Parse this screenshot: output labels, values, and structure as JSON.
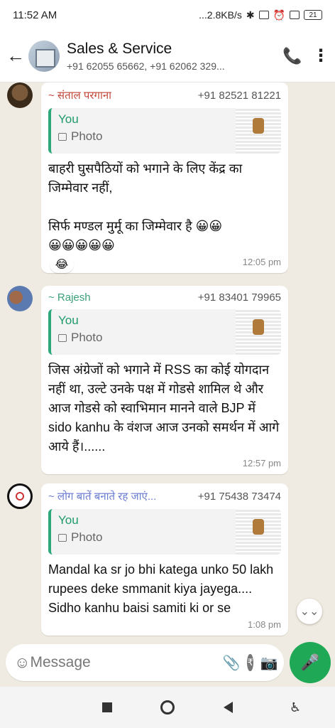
{
  "status_bar": {
    "time": "11:52 AM",
    "net_speed": "...2.8KB/s",
    "battery": "21"
  },
  "header": {
    "title": "Sales & Service",
    "members": "+91 62055 65662, +91 62062 329..."
  },
  "messages": [
    {
      "sender": "~ संताल परगाना",
      "sender_color": "#c2473a",
      "phone": "+91 82521 81221",
      "quote_author": "You",
      "quote_type": "Photo",
      "text": "बाहरी घुसपैठियों को भगाने के लिए केंद्र का जिम्मेवार नहीं,\n\nसिर्फ मण्डल मुर्मू का जिम्मेवार है 😀😀\n😀😀😀😀😀",
      "time": "12:05 pm",
      "reaction": "😂"
    },
    {
      "sender": "~ Rajesh",
      "sender_color": "#3aa07a",
      "phone": "+91 83401 79965",
      "quote_author": "You",
      "quote_type": "Photo",
      "text": "जिस अंग्रेजों को भगाने में RSS का कोई योगदान नहीं था, उल्टे उनके पक्ष में गोडसे शामिल थे और आज गोडसे को स्वाभिमान मानने वाले BJP में sido kanhu के वंशज आज उनको समर्थन में आगे आये हैं।......",
      "time": "12:57 pm"
    },
    {
      "sender": "~ लोग बातें बनाते रह जाएं...",
      "sender_color": "#6a7bd1",
      "phone": "+91 75438 73474",
      "quote_author": "You",
      "quote_type": "Photo",
      "text": "Mandal ka sr jo bhi katega unko 50 lakh rupees deke smmanit kiya jayega.... Sidho kanhu baisi samiti ki or se",
      "time": "1:08 pm"
    }
  ],
  "input": {
    "placeholder": "Message"
  },
  "icons": {
    "rupee": "₹"
  }
}
